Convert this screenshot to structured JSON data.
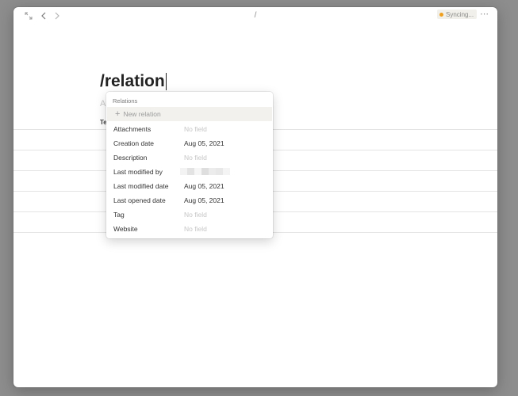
{
  "topbar": {
    "breadcrumb": "/",
    "sync_label": "Syncing...",
    "more_label": "⋯"
  },
  "note": {
    "title": "/relation",
    "placeholder_line": "A",
    "second_line": "Te"
  },
  "relations_menu": {
    "header": "Relations",
    "new_relation_label": "New relation",
    "items": [
      {
        "name": "Attachments",
        "value": "No field",
        "empty": true
      },
      {
        "name": "Creation date",
        "value": "Aug 05, 2021",
        "empty": false
      },
      {
        "name": "Description",
        "value": "No field",
        "empty": true
      },
      {
        "name": "Last modified by",
        "value": "",
        "empty": false
      },
      {
        "name": "Last modified date",
        "value": "Aug 05, 2021",
        "empty": false
      },
      {
        "name": "Last opened date",
        "value": "Aug 05, 2021",
        "empty": false
      },
      {
        "name": "Tag",
        "value": "No field",
        "empty": true
      },
      {
        "name": "Website",
        "value": "No field",
        "empty": true
      }
    ]
  },
  "colors": {
    "sync_dot": "#f0a020",
    "highlight": "#f2f1ee"
  }
}
